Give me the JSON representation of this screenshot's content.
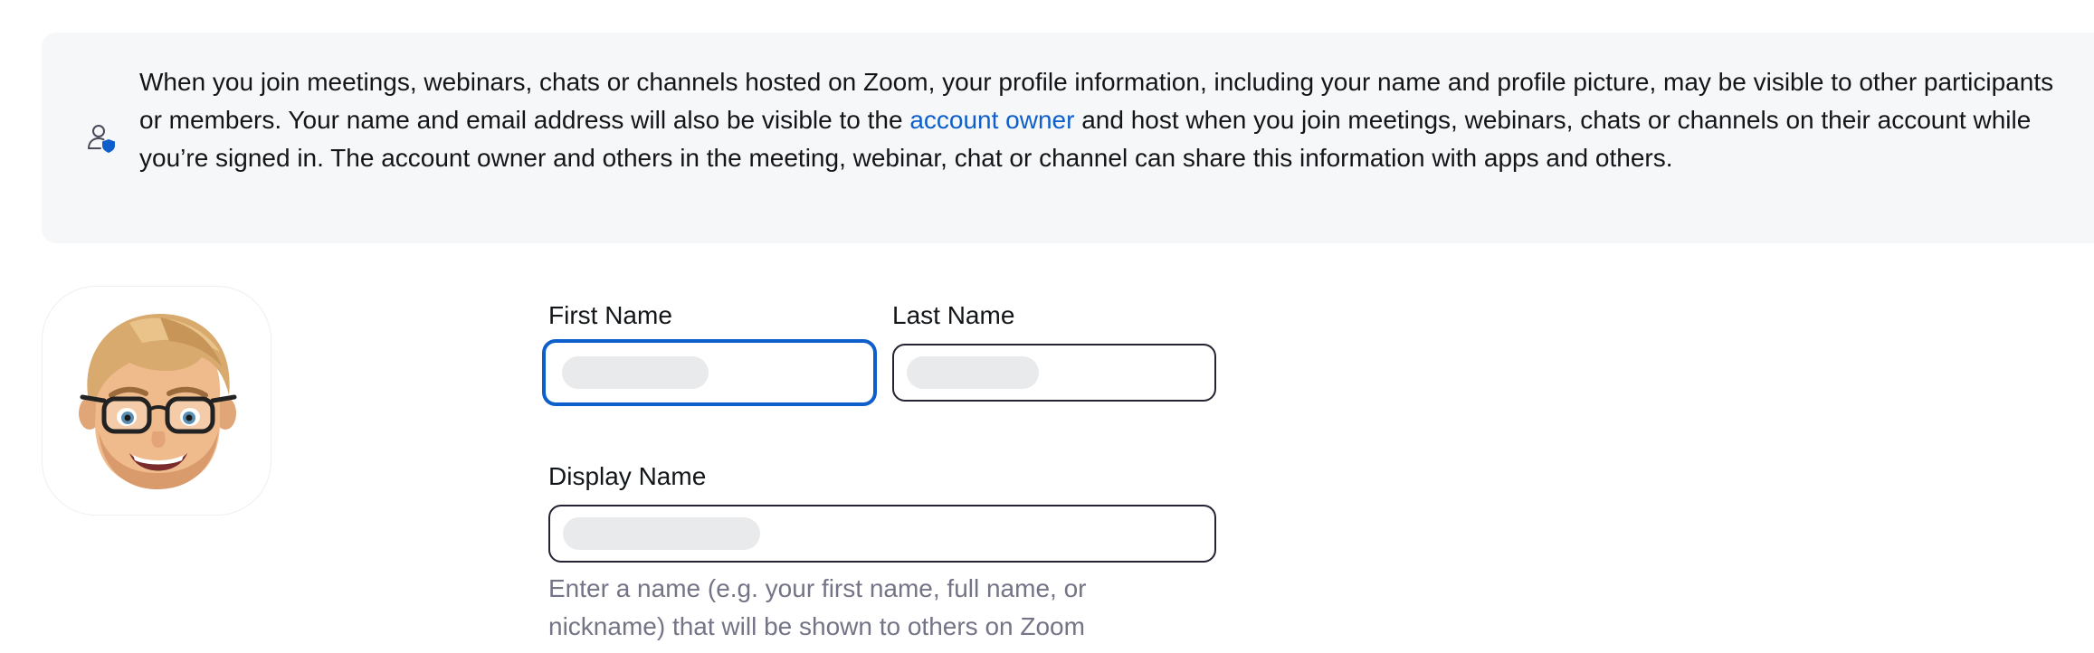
{
  "notice": {
    "icon": "user-shield-icon",
    "text_before_link": "When you join meetings, webinars, chats or channels hosted on Zoom, your profile information, including your name and profile picture, may be visible to other participants or members. Your name and email address will also be visible to the ",
    "link_label": "account owner",
    "text_after_link": " and host when you join meetings, webinars, chats or channels on their account while you’re signed in. The account owner and others in the meeting, webinar, chat or channel can share this information with apps and others.",
    "link_color": "#0e5fcc"
  },
  "avatar": {
    "icon": "memoji-avatar"
  },
  "form": {
    "first_name": {
      "label": "First Name",
      "value": ""
    },
    "last_name": {
      "label": "Last Name",
      "value": ""
    },
    "display_name": {
      "label": "Display Name",
      "value": "",
      "helper": "Enter a name (e.g. your first name, full name, or nickname) that will be shown to others on Zoom"
    }
  },
  "colors": {
    "accent": "#0e5fcc",
    "notice_bg": "#f6f7f9",
    "helper_text": "#747487"
  }
}
